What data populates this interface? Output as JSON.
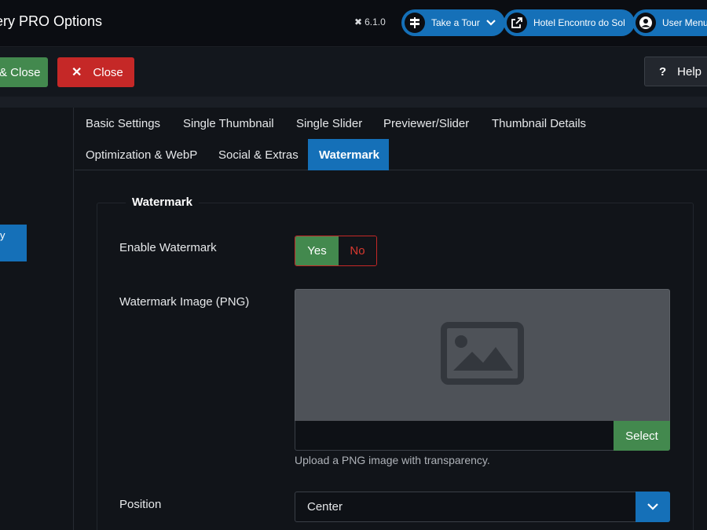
{
  "header": {
    "title": "ery PRO Options",
    "version": "6.1.0",
    "tour_label": "Take a Tour",
    "site_label": "Hotel Encontro do Sol",
    "user_label": "User Menu"
  },
  "toolbar": {
    "save_close_label": "& Close",
    "close_label": "Close",
    "help_label": "Help"
  },
  "sidebar": {
    "active_item_label": "y"
  },
  "tabs": [
    {
      "label": "Basic Settings"
    },
    {
      "label": "Single Thumbnail"
    },
    {
      "label": "Single Slider"
    },
    {
      "label": "Previewer/Slider"
    },
    {
      "label": "Thumbnail Details"
    },
    {
      "label": "Optimization & WebP"
    },
    {
      "label": "Social & Extras"
    },
    {
      "label": "Watermark",
      "active": true
    }
  ],
  "watermark": {
    "legend": "Watermark",
    "enable_label": "Enable Watermark",
    "yes_label": "Yes",
    "no_label": "No",
    "enabled": "Yes",
    "image_label": "Watermark Image (PNG)",
    "image_value": "",
    "select_label": "Select",
    "hint": "Upload a PNG image with transparency.",
    "position_label": "Position",
    "position_value": "Center"
  },
  "colors": {
    "primary": "#1570b8",
    "success": "#43894e",
    "danger": "#c52827",
    "background": "#111419"
  },
  "icons": {
    "joomla": "joomla-icon",
    "tour": "signpost-icon",
    "site": "external-link-icon",
    "user": "user-circle-icon",
    "close": "x-icon",
    "help": "question-icon",
    "placeholder": "image-placeholder-icon",
    "dropdown": "chevron-down-icon"
  }
}
